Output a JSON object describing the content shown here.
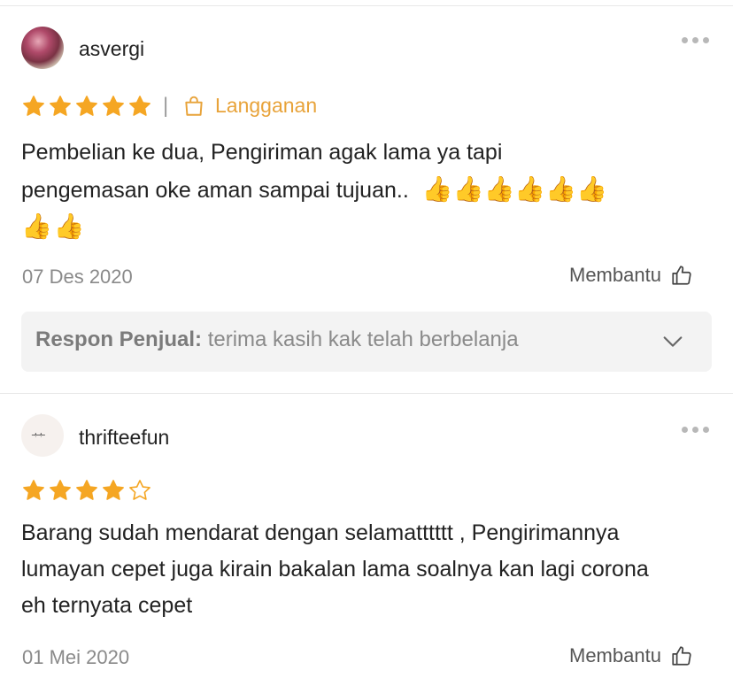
{
  "reviews": [
    {
      "username": "asvergi",
      "rating": 5,
      "variant_label": "Langganan",
      "text_line1": "Pembelian ke dua, Pengiriman agak lama ya tapi",
      "text_line2": "pengemasan oke aman sampai tujuan..",
      "emoji_line1": "👍👍👍👍👍👍",
      "emoji_line2": "👍👍",
      "date": "07 Des 2020",
      "helpful_label": "Membantu",
      "seller_response": {
        "label": "Respon Penjual:",
        "text": "terima kasih kak telah berbelanja"
      }
    },
    {
      "username": "thrifteefun",
      "avatar_text": "ـبـبـ",
      "rating": 4,
      "text": "Barang sudah mendarat dengan selamatttttt , Pengirimannya lumayan cepet juga kirain bakalan lama soalnya kan lagi corona eh ternyata cepet",
      "date": "01 Mei 2020",
      "helpful_label": "Membantu"
    }
  ],
  "colors": {
    "star": "#f5a623",
    "variant": "#e8a33a",
    "response_bg": "#f3f3f3"
  },
  "icons": {
    "more": "more-horizontal-icon",
    "bag": "shopping-bag-icon",
    "like": "thumbs-up-icon",
    "chevron": "chevron-down-icon"
  }
}
